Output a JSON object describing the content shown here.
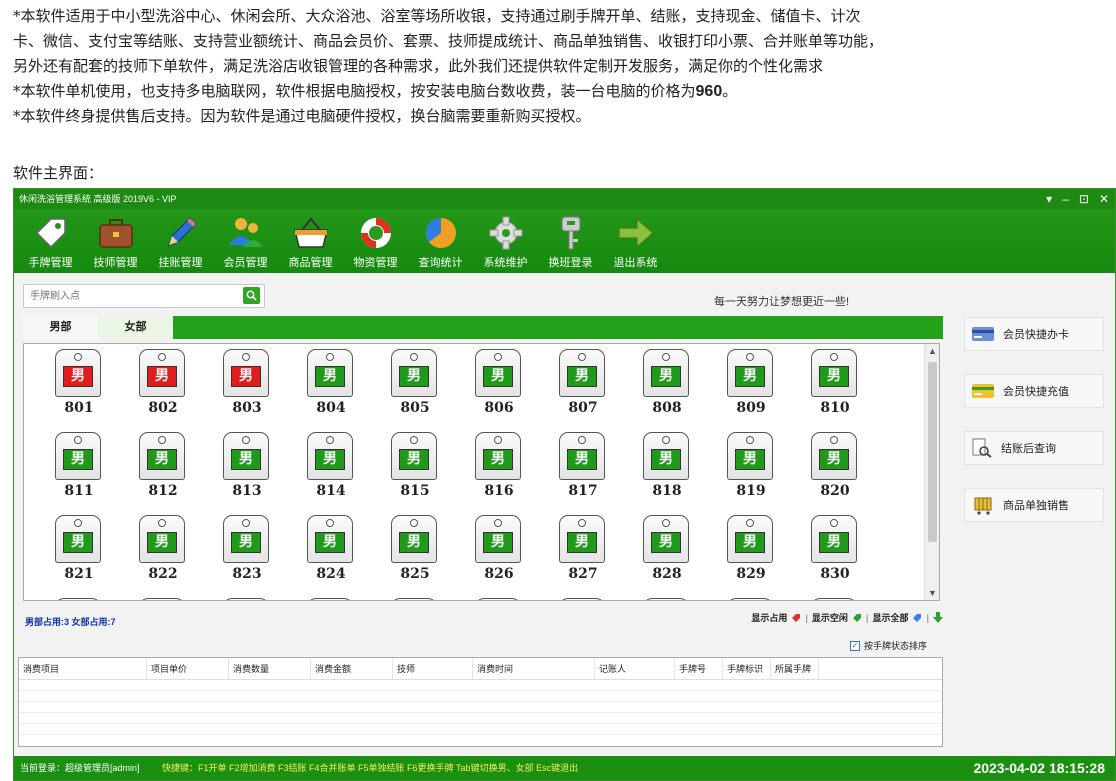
{
  "intro": {
    "line1": "*本软件适用于中小型洗浴中心、休闲会所、大众浴池、浴室等场所收银，支持通过刷手牌开单、结账，支持现金、储值卡、计次",
    "line2": "卡、微信、支付宝等结账、支持营业额统计、商品会员价、套票、技师提成统计、商品单独销售、收银打印小票、合并账单等功能，",
    "line3": "另外还有配套的技师下单软件，满足洗浴店收银管理的各种需求，此外我们还提供软件定制开发服务，满足你的个性化需求",
    "line4_pre": "*本软件单机使用，也支持多电脑联网，软件根据电脑授权，按安装电脑台数收费，装一台电脑的价格为",
    "line4_price": "960",
    "line4_post": "。",
    "line5": "*本软件终身提供售后支持。因为软件是通过电脑硬件授权，换台脑需要重新购买授权。",
    "main_label": "软件主界面："
  },
  "window": {
    "title": "休闲洗浴管理系统 高级版 2019V6 - VIP",
    "controls": [
      "▾",
      "–",
      "⊡",
      "✕"
    ]
  },
  "toolbar": [
    {
      "label": "手牌管理",
      "icon": "tag-icon",
      "color": "#ffffff"
    },
    {
      "label": "技师管理",
      "icon": "briefcase-icon",
      "color": "#a0522d"
    },
    {
      "label": "挂账管理",
      "icon": "pencil-icon",
      "color": "#2a6fd1"
    },
    {
      "label": "会员管理",
      "icon": "members-icon",
      "color": "#2b7be0"
    },
    {
      "label": "商品管理",
      "icon": "basket-icon",
      "color": "#ffffff"
    },
    {
      "label": "物资管理",
      "icon": "lifebuoy-icon",
      "color": "#e03020"
    },
    {
      "label": "查询统计",
      "icon": "pie-chart-icon",
      "color": "#f0a020"
    },
    {
      "label": "系统维护",
      "icon": "gear-icon",
      "color": "#dddddd"
    },
    {
      "label": "换班登录",
      "icon": "key-icon",
      "color": "#cccccc"
    },
    {
      "label": "退出系统",
      "icon": "exit-arrow-icon",
      "color": "#88c040"
    }
  ],
  "search": {
    "placeholder": "手牌刷入点"
  },
  "slogan": "每一天努力让梦想更近一些!",
  "tabs": [
    "男部",
    "女部"
  ],
  "tags": {
    "sex_label": "男",
    "items": [
      {
        "num": "801",
        "busy": true
      },
      {
        "num": "802",
        "busy": true
      },
      {
        "num": "803",
        "busy": true
      },
      {
        "num": "804",
        "busy": false
      },
      {
        "num": "805",
        "busy": false
      },
      {
        "num": "806",
        "busy": false
      },
      {
        "num": "807",
        "busy": false
      },
      {
        "num": "808",
        "busy": false
      },
      {
        "num": "809",
        "busy": false
      },
      {
        "num": "810",
        "busy": false
      },
      {
        "num": "811",
        "busy": false
      },
      {
        "num": "812",
        "busy": false
      },
      {
        "num": "813",
        "busy": false
      },
      {
        "num": "814",
        "busy": false
      },
      {
        "num": "815",
        "busy": false
      },
      {
        "num": "816",
        "busy": false
      },
      {
        "num": "817",
        "busy": false
      },
      {
        "num": "818",
        "busy": false
      },
      {
        "num": "819",
        "busy": false
      },
      {
        "num": "820",
        "busy": false
      },
      {
        "num": "821",
        "busy": false
      },
      {
        "num": "822",
        "busy": false
      },
      {
        "num": "823",
        "busy": false
      },
      {
        "num": "824",
        "busy": false
      },
      {
        "num": "825",
        "busy": false
      },
      {
        "num": "826",
        "busy": false
      },
      {
        "num": "827",
        "busy": false
      },
      {
        "num": "828",
        "busy": false
      },
      {
        "num": "829",
        "busy": false
      },
      {
        "num": "830",
        "busy": false
      }
    ]
  },
  "occupancy": "男部占用:3 女部占用:7",
  "filters": {
    "show_busy": "显示占用",
    "show_free": "显示空闲",
    "show_all": "显示全部"
  },
  "sort_label": "按手牌状态排序",
  "table_headers": [
    "消费项目",
    "项目单价",
    "消费数量",
    "消费金额",
    "技师",
    "消费时间",
    "记账人",
    "手牌号",
    "手牌标识",
    "所属手牌"
  ],
  "side_buttons": [
    {
      "label": "会员快捷办卡",
      "icon": "card-icon"
    },
    {
      "label": "会员快捷充值",
      "icon": "recharge-card-icon"
    },
    {
      "label": "结账后查询",
      "icon": "search-document-icon"
    },
    {
      "label": "商品单独销售",
      "icon": "cart-icon"
    }
  ],
  "statusbar": {
    "login": "当前登录：超级管理员[admin]",
    "hotkeys": "快捷键：F1开单  F2增加消费  F3结账  F4合并账单  F5单独结账  F6更换手牌  Tab键切换男、女部  Esc键退出",
    "datetime": "2023-04-02 18:15:28"
  }
}
